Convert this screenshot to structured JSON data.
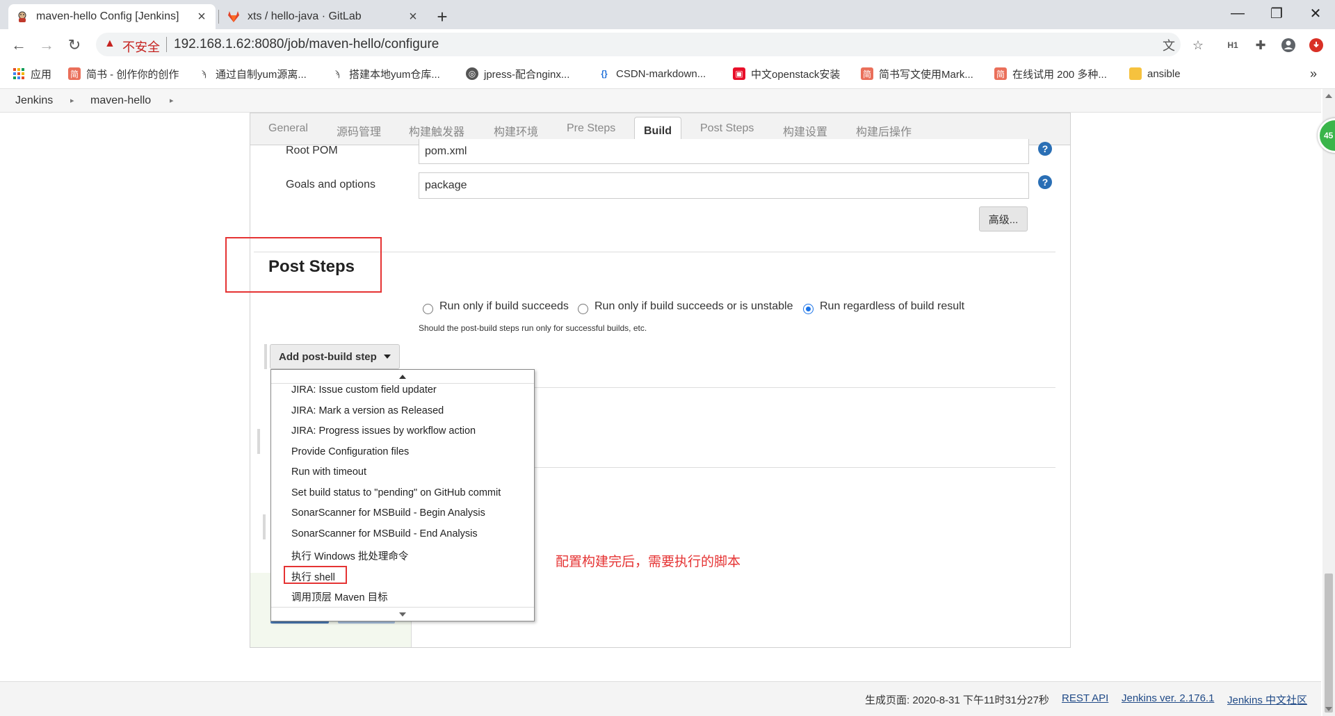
{
  "browser": {
    "tabs": [
      {
        "title": "maven-hello Config [Jenkins]",
        "active": true
      },
      {
        "title": "xts / hello-java · GitLab",
        "active": false
      }
    ],
    "security_label": "不安全",
    "url": "192.168.1.62:8080/job/maven-hello/configure",
    "bookmarks": [
      {
        "label": "应用",
        "icon": "apps-grid-icon",
        "color": "#e44d26"
      },
      {
        "label": "简书 - 创作你的创作",
        "icon": "jianshu-icon",
        "color": "#ea6f5a"
      },
      {
        "label": "通过自制yum源离...",
        "icon": "bookmark-page-icon",
        "color": "#555555"
      },
      {
        "label": "搭建本地yum仓库...",
        "icon": "bookmark-page-icon",
        "color": "#555555"
      },
      {
        "label": "jpress-配合nginx...",
        "icon": "globe-icon",
        "color": "#555555"
      },
      {
        "label": "CSDN-markdown...",
        "icon": "csdn-icon",
        "color": "#1e6fd9"
      },
      {
        "label": "中文openstack安装",
        "icon": "openstack-icon",
        "color": "#e8102a"
      },
      {
        "label": "简书写文使用Mark...",
        "icon": "jianshu-icon",
        "color": "#ea6f5a"
      },
      {
        "label": "在线试用 200 多种...",
        "icon": "jianshu-icon",
        "color": "#ea6f5a"
      },
      {
        "label": "ansible",
        "icon": "folder-icon",
        "color": "#f6c23e"
      }
    ],
    "bookmarks_more": "»"
  },
  "breadcrumb": {
    "items": [
      "Jenkins",
      "maven-hello"
    ]
  },
  "config_tabs": [
    "General",
    "源码管理",
    "构建触发器",
    "构建环境",
    "Pre Steps",
    "Build",
    "Post Steps",
    "构建设置",
    "构建后操作"
  ],
  "active_tab": "Build",
  "build": {
    "root_pom_label": "Root POM",
    "root_pom_value": "pom.xml",
    "goals_label": "Goals and options",
    "goals_value": "package",
    "advanced_button": "高级..."
  },
  "post_steps": {
    "title": "Post Steps",
    "radio_options": [
      {
        "label": "Run only if build succeeds",
        "checked": false
      },
      {
        "label": "Run only if build succeeds or is unstable",
        "checked": false
      },
      {
        "label": "Run regardless of build result",
        "checked": true
      }
    ],
    "description": "Should the post-build steps run only for successful builds, etc.",
    "add_button": "Add post-build step"
  },
  "dropdown": {
    "items": [
      "JIRA: Issue custom field updater",
      "JIRA: Mark a version as Released",
      "JIRA: Progress issues by workflow action",
      "Provide Configuration files",
      "Run with timeout",
      "Set build status to \"pending\" on GitHub commit",
      "SonarScanner for MSBuild - Begin Analysis",
      "SonarScanner for MSBuild - End Analysis",
      "执行 Windows 批处理命令",
      "执行 shell",
      "调用顶层 Maven 目标"
    ],
    "highlighted": "执行 shell"
  },
  "annotation": "配置构建完后，需要执行的脚本",
  "footer": {
    "generated": "生成页面: 2020-8-31 下午11时31分27秒",
    "rest_api": "REST API",
    "version": "Jenkins ver. 2.176.1",
    "community": "Jenkins 中文社区"
  },
  "side_badge": "45",
  "colors": {
    "annotation_red": "#e53333",
    "help_blue": "#2a6fb5",
    "radio_blue": "#1a73e8",
    "badge_green": "#3ab54a"
  }
}
